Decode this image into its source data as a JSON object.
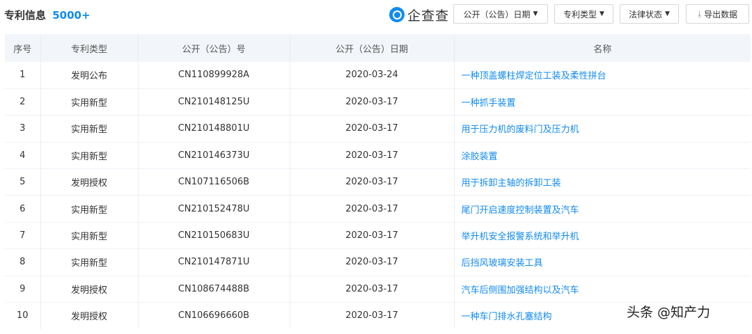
{
  "header": {
    "title": "专利信息",
    "count": "5000+",
    "logo_text": "企查查",
    "filters": [
      "公开（公告）日期",
      "专利类型",
      "法律状态"
    ],
    "export_label": "导出数据"
  },
  "table": {
    "columns": [
      "序号",
      "专利类型",
      "公开（公告）号",
      "公开（公告）日期",
      "名称"
    ],
    "rows": [
      [
        "1",
        "发明公布",
        "CN110899928A",
        "2020-03-24",
        "一种顶盖螺柱焊定位工装及柔性拼台"
      ],
      [
        "2",
        "实用新型",
        "CN210148125U",
        "2020-03-17",
        "一种抓手装置"
      ],
      [
        "3",
        "实用新型",
        "CN210148801U",
        "2020-03-17",
        "用于压力机的废料门及压力机"
      ],
      [
        "4",
        "实用新型",
        "CN210146373U",
        "2020-03-17",
        "涂胶装置"
      ],
      [
        "5",
        "发明授权",
        "CN107116506B",
        "2020-03-17",
        "用于拆卸主轴的拆卸工装"
      ],
      [
        "6",
        "实用新型",
        "CN210152478U",
        "2020-03-17",
        "尾门开启速度控制装置及汽车"
      ],
      [
        "7",
        "实用新型",
        "CN210150683U",
        "2020-03-17",
        "举升机安全报警系统和举升机"
      ],
      [
        "8",
        "实用新型",
        "CN210147871U",
        "2020-03-17",
        "后挡风玻璃安装工具"
      ],
      [
        "9",
        "发明授权",
        "CN108674488B",
        "2020-03-17",
        "汽车后侧围加强结构以及汽车"
      ],
      [
        "10",
        "发明授权",
        "CN106696660B",
        "2020-03-17",
        "一种车门排水孔塞结构"
      ]
    ]
  },
  "watermark": "头条 @知产力",
  "icons": {
    "logo": "qichacha-logo-icon",
    "caret": "caret-down-icon",
    "export": "download-icon"
  },
  "colors": {
    "accent": "#128bed",
    "header_bg": "#f2f6fa"
  }
}
